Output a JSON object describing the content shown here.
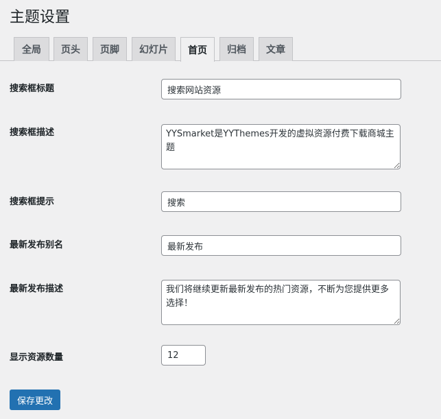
{
  "page_title": "主题设置",
  "tabs": [
    {
      "label": "全局"
    },
    {
      "label": "页头"
    },
    {
      "label": "页脚"
    },
    {
      "label": "幻灯片"
    },
    {
      "label": "首页",
      "active": true
    },
    {
      "label": "归档"
    },
    {
      "label": "文章"
    }
  ],
  "fields": {
    "search_title": {
      "label": "搜索框标题",
      "value": "搜索网站资源"
    },
    "search_desc": {
      "label": "搜索框描述",
      "value": "YYSmarket是YYThemes开发的虚拟资源付费下载商城主题"
    },
    "search_hint": {
      "label": "搜索框提示",
      "value": "搜索"
    },
    "latest_alias": {
      "label": "最新发布别名",
      "value": "最新发布"
    },
    "latest_desc": {
      "label": "最新发布描述",
      "value": "我们将继续更新最新发布的热门资源，不断为您提供更多选择！"
    },
    "resource_count": {
      "label": "显示资源数量",
      "value": "12"
    }
  },
  "save_label": "保存更改",
  "colors": {
    "primary": "#2271b1",
    "background": "#f0f0f1"
  }
}
